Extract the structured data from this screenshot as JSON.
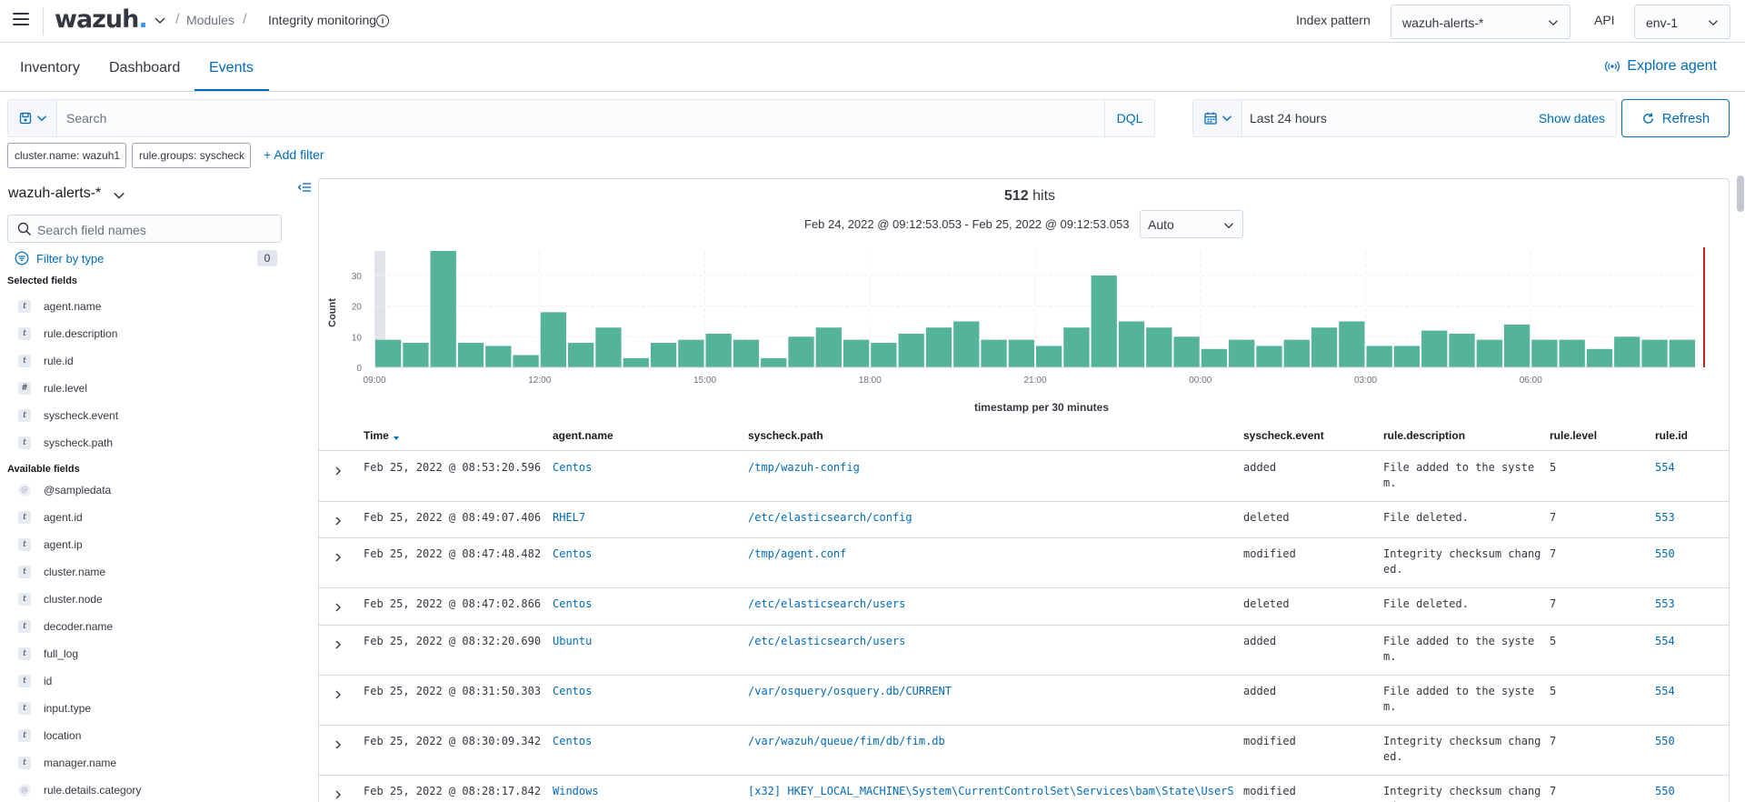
{
  "header": {
    "logo": "wazuh",
    "logo_dot": ".",
    "breadcrumb_sep": "/",
    "breadcrumb_modules": "Modules",
    "breadcrumb_current": "Integrity monitoring",
    "index_pattern_label": "Index pattern",
    "index_pattern_value": "wazuh-alerts-*",
    "api_label": "API",
    "api_value": "env-1"
  },
  "tabs": [
    "Inventory",
    "Dashboard",
    "Events"
  ],
  "active_tab": "Events",
  "explore_agent": "Explore agent",
  "search": {
    "placeholder": "Search",
    "language": "DQL"
  },
  "date": {
    "range": "Last 24 hours",
    "show_dates": "Show dates",
    "refresh": "Refresh"
  },
  "filters": [
    "cluster.name: wazuh1",
    "rule.groups: syscheck"
  ],
  "add_filter": "+ Add filter",
  "sidebar": {
    "index_title": "wazuh-alerts-*",
    "search_placeholder": "Search field names",
    "filter_by_type": "Filter by type",
    "filter_count": "0",
    "selected_label": "Selected fields",
    "selected_fields": [
      {
        "type": "t",
        "name": "agent.name"
      },
      {
        "type": "t",
        "name": "rule.description"
      },
      {
        "type": "t",
        "name": "rule.id"
      },
      {
        "type": "#",
        "name": "rule.level"
      },
      {
        "type": "t",
        "name": "syscheck.event"
      },
      {
        "type": "t",
        "name": "syscheck.path"
      }
    ],
    "available_label": "Available fields",
    "available_fields": [
      {
        "type": "@",
        "name": "@sampledata"
      },
      {
        "type": "t",
        "name": "agent.id"
      },
      {
        "type": "t",
        "name": "agent.ip"
      },
      {
        "type": "t",
        "name": "cluster.name"
      },
      {
        "type": "t",
        "name": "cluster.node"
      },
      {
        "type": "t",
        "name": "decoder.name"
      },
      {
        "type": "t",
        "name": "full_log"
      },
      {
        "type": "t",
        "name": "id"
      },
      {
        "type": "t",
        "name": "input.type"
      },
      {
        "type": "t",
        "name": "location"
      },
      {
        "type": "t",
        "name": "manager.name"
      },
      {
        "type": "@",
        "name": "rule.details.category"
      }
    ]
  },
  "summary": {
    "hits_count": "512",
    "hits_label": "hits",
    "time_range": "Feb 24, 2022 @ 09:12:53.053 - Feb 25, 2022 @ 09:12:53.053",
    "interval": "Auto"
  },
  "chart_data": {
    "type": "bar",
    "ylabel": "Count",
    "xlabel": "timestamp per 30 minutes",
    "yticks": [
      0,
      10,
      20,
      30
    ],
    "ylim": [
      0,
      38
    ],
    "xticks": [
      "09:00",
      "12:00",
      "15:00",
      "18:00",
      "21:00",
      "00:00",
      "03:00",
      "06:00"
    ],
    "values": [
      9,
      8,
      38,
      8,
      7,
      4,
      18,
      8,
      13,
      3,
      8,
      9,
      11,
      9,
      3,
      10,
      13,
      9,
      8,
      11,
      13,
      15,
      9,
      9,
      7,
      13,
      30,
      15,
      13,
      10,
      6,
      9,
      7,
      9,
      13,
      15,
      7,
      7,
      12,
      11,
      9,
      14,
      9,
      9,
      6,
      10,
      9,
      9
    ],
    "color": "#54b399",
    "marker_color": "#bd271e"
  },
  "table": {
    "columns": [
      "Time",
      "agent.name",
      "syscheck.path",
      "syscheck.event",
      "rule.description",
      "rule.level",
      "rule.id"
    ],
    "rows": [
      {
        "time": "Feb 25, 2022 @ 08:53:20.596",
        "agent": "Centos",
        "path": "/tmp/wazuh-config",
        "event": "added",
        "desc": "File added to the system.",
        "level": "5",
        "id": "554"
      },
      {
        "time": "Feb 25, 2022 @ 08:49:07.406",
        "agent": "RHEL7",
        "path": "/etc/elasticsearch/config",
        "event": "deleted",
        "desc": "File deleted.",
        "level": "7",
        "id": "553"
      },
      {
        "time": "Feb 25, 2022 @ 08:47:48.482",
        "agent": "Centos",
        "path": "/tmp/agent.conf",
        "event": "modified",
        "desc": "Integrity checksum changed.",
        "level": "7",
        "id": "550"
      },
      {
        "time": "Feb 25, 2022 @ 08:47:02.866",
        "agent": "Centos",
        "path": "/etc/elasticsearch/users",
        "event": "deleted",
        "desc": "File deleted.",
        "level": "7",
        "id": "553"
      },
      {
        "time": "Feb 25, 2022 @ 08:32:20.690",
        "agent": "Ubuntu",
        "path": "/etc/elasticsearch/users",
        "event": "added",
        "desc": "File added to the system.",
        "level": "5",
        "id": "554"
      },
      {
        "time": "Feb 25, 2022 @ 08:31:50.303",
        "agent": "Centos",
        "path": "/var/osquery/osquery.db/CURRENT",
        "event": "added",
        "desc": "File added to the system.",
        "level": "5",
        "id": "554"
      },
      {
        "time": "Feb 25, 2022 @ 08:30:09.342",
        "agent": "Centos",
        "path": "/var/wazuh/queue/fim/db/fim.db",
        "event": "modified",
        "desc": "Integrity checksum changed.",
        "level": "7",
        "id": "550"
      },
      {
        "time": "Feb 25, 2022 @ 08:28:17.842",
        "agent": "Windows",
        "path": "[x32] HKEY_LOCAL_MACHINE\\System\\CurrentControlSet\\Services\\bam\\State\\UserS",
        "event": "modified",
        "desc": "Integrity checksum changed.",
        "level": "7",
        "id": "550"
      }
    ]
  }
}
